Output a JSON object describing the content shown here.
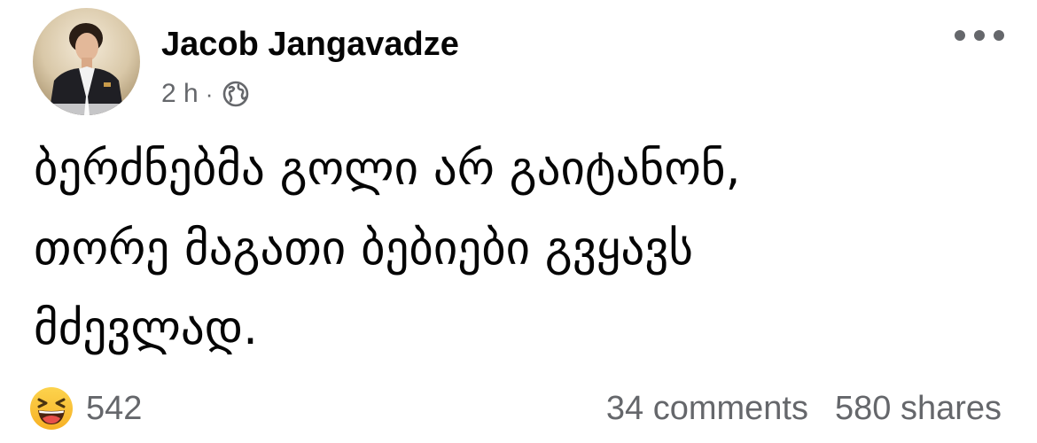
{
  "post": {
    "author": "Jacob Jangavadze",
    "timestamp": "2 h",
    "separator": "·",
    "privacy_icon": "globe-icon",
    "more_icon": "more-horizontal-icon",
    "lines": [
      "ბერძნებმა გოლი არ გაიტანონ,",
      "თორე მაგათი ბებიები გვყავს",
      "მძევლად."
    ]
  },
  "footer": {
    "reaction_icon": "haha-emoji-icon",
    "reaction_count": "542",
    "comments": "34 comments",
    "shares": "580 shares"
  },
  "colors": {
    "text_primary": "#050505",
    "text_secondary": "#65676b",
    "reaction_yellow": "#f7b125"
  }
}
